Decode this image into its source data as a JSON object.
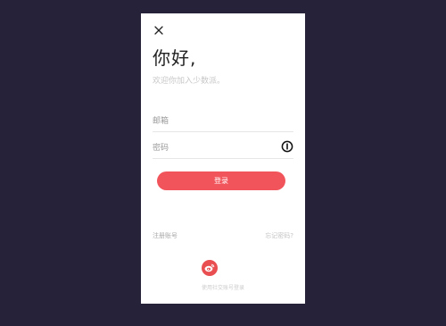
{
  "login": {
    "greeting": "你好,",
    "welcome": "欢迎你加入少数派。",
    "email_placeholder": "邮箱",
    "password_placeholder": "密码",
    "login_button": "登录",
    "register_link": "注册账号",
    "forgot_link": "忘记密码?",
    "social_label": "使用社交账号登录"
  },
  "icons": {
    "close": "close-icon",
    "password_visibility": "info-circle-icon",
    "social": "weibo-icon"
  },
  "colors": {
    "background": "#26223a",
    "card": "#ffffff",
    "accent": "#f2545b",
    "weibo": "#e94e50"
  }
}
